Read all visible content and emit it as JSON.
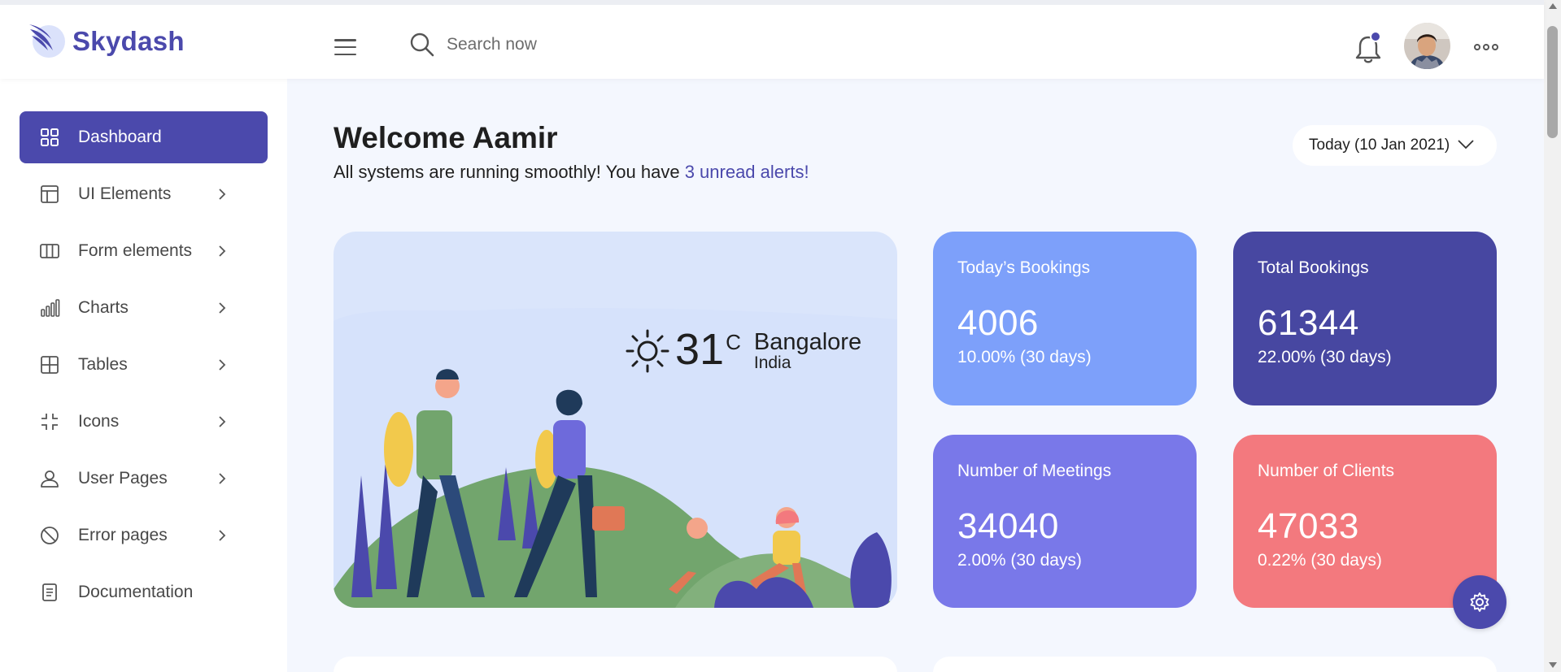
{
  "brand": {
    "name": "Skydash",
    "color": "#4b49ac"
  },
  "header": {
    "search_placeholder": "Search now",
    "icons": [
      "hamburger-menu-icon",
      "search-icon",
      "bell-icon",
      "more-options-icon"
    ]
  },
  "sidebar": {
    "items": [
      {
        "label": "Dashboard",
        "icon": "grid-icon",
        "active": true,
        "has_submenu": false
      },
      {
        "label": "UI Elements",
        "icon": "layout-icon",
        "active": false,
        "has_submenu": true
      },
      {
        "label": "Form elements",
        "icon": "columns-icon",
        "active": false,
        "has_submenu": true
      },
      {
        "label": "Charts",
        "icon": "bar-chart-icon",
        "active": false,
        "has_submenu": true
      },
      {
        "label": "Tables",
        "icon": "table-icon",
        "active": false,
        "has_submenu": true
      },
      {
        "label": "Icons",
        "icon": "shrink-icon",
        "active": false,
        "has_submenu": true
      },
      {
        "label": "User Pages",
        "icon": "user-icon",
        "active": false,
        "has_submenu": true
      },
      {
        "label": "Error pages",
        "icon": "ban-icon",
        "active": false,
        "has_submenu": true
      },
      {
        "label": "Documentation",
        "icon": "document-icon",
        "active": false,
        "has_submenu": false
      }
    ]
  },
  "main": {
    "welcome_title": "Welcome Aamir",
    "welcome_text": "All systems are running smoothly! You have ",
    "alerts_link": "3 unread alerts!",
    "date_button": "Today (10 Jan 2021)",
    "weather": {
      "temperature": "31",
      "unit": "C",
      "city": "Bangalore",
      "country": "India",
      "icon": "sun-icon"
    },
    "stats": [
      {
        "title": "Today’s Bookings",
        "value": "4006",
        "change": "10.00% (30 days)",
        "color": "#7da0fa"
      },
      {
        "title": "Total Bookings",
        "value": "61344",
        "change": "22.00% (30 days)",
        "color": "#4747a1"
      },
      {
        "title": "Number of Meetings",
        "value": "34040",
        "change": "2.00% (30 days)",
        "color": "#7978e9"
      },
      {
        "title": "Number of Clients",
        "value": "47033",
        "change": "0.22% (30 days)",
        "color": "#f3797e"
      }
    ]
  },
  "settings_fab_icon": "gear-icon"
}
